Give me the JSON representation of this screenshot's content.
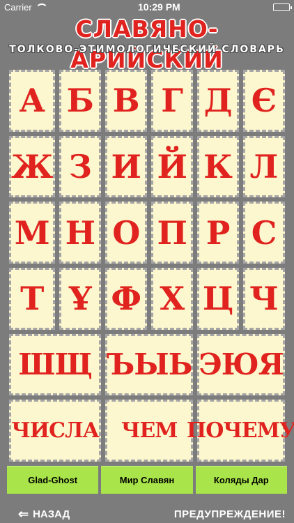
{
  "status_bar": {
    "carrier": "Carrier",
    "time": "10:29 PM"
  },
  "header": {
    "title": "СЛАВЯНО-АРИЙСКИЙ",
    "subtitle": "ТОЛКОВО-ЭТИМОЛОГИЧЕСКИЙ СЛОВАРЬ"
  },
  "letters": {
    "row1": [
      "А",
      "Б",
      "В",
      "Г",
      "Д",
      "Є"
    ],
    "row2": [
      "Ж",
      "З",
      "И",
      "Й",
      "К",
      "Л"
    ],
    "row3": [
      "М",
      "Н",
      "О",
      "П",
      "Р",
      "С"
    ],
    "row4": [
      "Т",
      "Ұ",
      "Ф",
      "Х",
      "Ц",
      "Ч"
    ],
    "row5": [
      "ШЩ",
      "ЪЫЬ",
      "ЭЮЯ"
    ],
    "row6": [
      "ЧИСЛА",
      "ЧЕМ",
      "ПОЧЕМУ"
    ]
  },
  "links": [
    "Glad-Ghost",
    "Мир Славян",
    "Коляды Дар"
  ],
  "bottom_bar": {
    "back_label": "НАЗАД",
    "warning_label": "ПРЕДУПРЕЖДЕНИЕ!"
  },
  "colors": {
    "accent": "#e0231e",
    "tile_bg": "#fdf7cf",
    "link_bg": "#a9e54a",
    "screen_bg": "#7c7c7c"
  }
}
